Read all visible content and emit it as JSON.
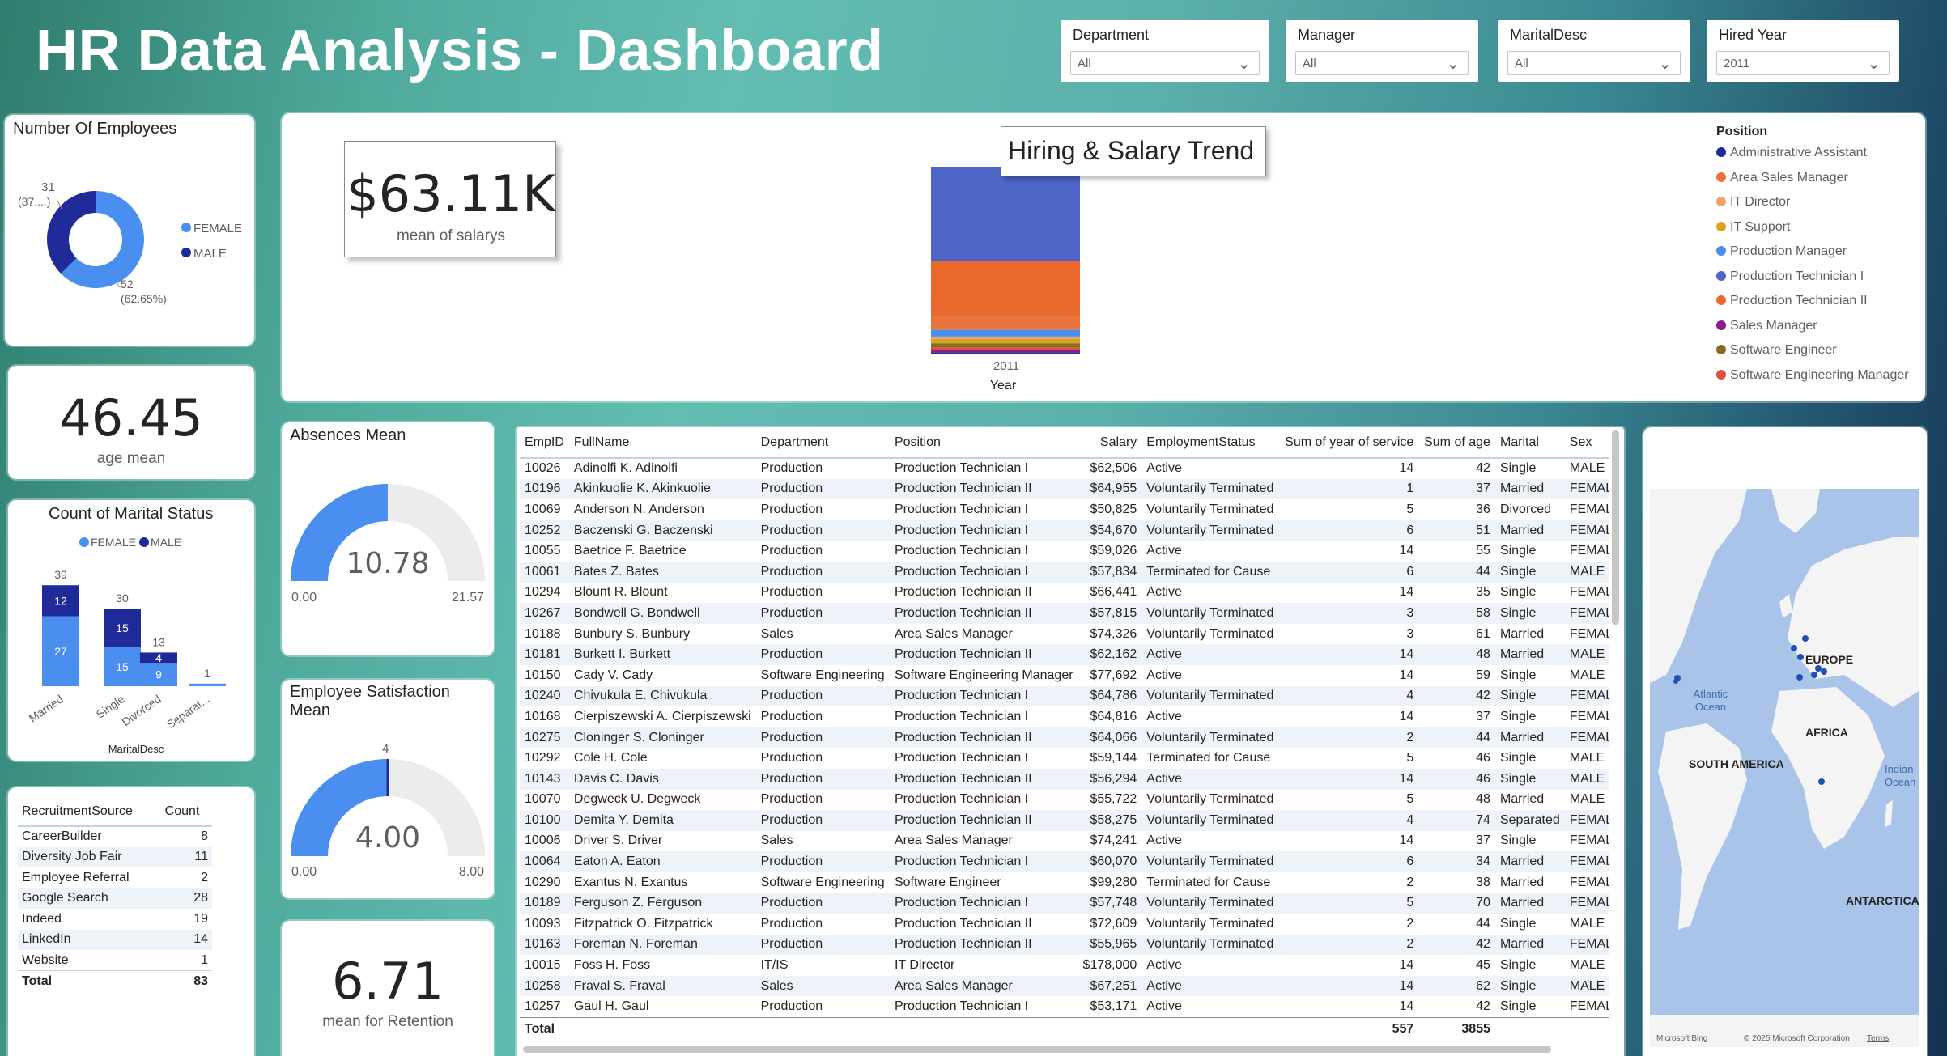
{
  "title": "HR Data Analysis - Dashboard",
  "slicers": [
    {
      "label": "Department",
      "value": "All"
    },
    {
      "label": "Manager",
      "value": "All"
    },
    {
      "label": "MaritalDesc",
      "value": "All"
    },
    {
      "label": "Hired Year",
      "value": "2011"
    }
  ],
  "employees_card": {
    "title": "Number Of Employees",
    "male_label_count": "31",
    "male_label_pct": "(37....)",
    "female_label_count": "52",
    "female_label_pct": "(62.65%)",
    "legend": [
      {
        "name": "FEMALE",
        "color": "#4a8ef0"
      },
      {
        "name": "MALE",
        "color": "#1f2b99"
      }
    ]
  },
  "age_card": {
    "value": "46.45",
    "label": "age mean"
  },
  "marital_card": {
    "title": "Count of Marital Status",
    "legend": [
      "FEMALE",
      "MALE"
    ],
    "xlabel": "MaritalDesc"
  },
  "recruitment": {
    "headers": [
      "RecruitmentSource",
      "Count"
    ],
    "rows": [
      [
        "CareerBuilder",
        "8"
      ],
      [
        "Diversity Job Fair",
        "11"
      ],
      [
        "Employee Referral",
        "2"
      ],
      [
        "Google Search",
        "28"
      ],
      [
        "Indeed",
        "19"
      ],
      [
        "LinkedIn",
        "14"
      ],
      [
        "Website",
        "1"
      ]
    ],
    "total_label": "Total",
    "total_value": "83"
  },
  "salary_card": {
    "value": "$63.11K",
    "label": "mean of salarys"
  },
  "trend": {
    "title": "Hiring & Salary Trend",
    "x_tick": "2011",
    "xlabel": "Year",
    "legend_title": "Position"
  },
  "absences": {
    "title": "Absences Mean",
    "value": "10.78",
    "min": "0.00",
    "max": "21.57"
  },
  "satisfaction": {
    "title_line1": "Employee Satisfaction",
    "title_line2": "Mean",
    "value": "4.00",
    "min": "0.00",
    "max": "8.00",
    "target": "4"
  },
  "retention": {
    "value": "6.71",
    "label": "mean for Retention"
  },
  "employee_table": {
    "headers": [
      "EmpID",
      "FullName",
      "Department",
      "Position",
      "Salary",
      "EmploymentStatus",
      "Sum of year of service",
      "Sum of age",
      "Marital",
      "Sex"
    ],
    "rows": [
      [
        "10026",
        "Adinolfi K. Adinolfi",
        "Production",
        "Production Technician I",
        "$62,506",
        "Active",
        "14",
        "42",
        "Single",
        "MALE"
      ],
      [
        "10196",
        "Akinkuolie K. Akinkuolie",
        "Production",
        "Production Technician II",
        "$64,955",
        "Voluntarily Terminated",
        "1",
        "37",
        "Married",
        "FEMAL"
      ],
      [
        "10069",
        "Anderson N. Anderson",
        "Production",
        "Production Technician I",
        "$50,825",
        "Voluntarily Terminated",
        "5",
        "36",
        "Divorced",
        "FEMAL"
      ],
      [
        "10252",
        "Baczenski G. Baczenski",
        "Production",
        "Production Technician I",
        "$54,670",
        "Voluntarily Terminated",
        "6",
        "51",
        "Married",
        "FEMAL"
      ],
      [
        "10055",
        "Baetrice F. Baetrice",
        "Production",
        "Production Technician I",
        "$59,026",
        "Active",
        "14",
        "55",
        "Single",
        "FEMAL"
      ],
      [
        "10061",
        "Bates Z. Bates",
        "Production",
        "Production Technician I",
        "$57,834",
        "Terminated for Cause",
        "6",
        "44",
        "Single",
        "MALE"
      ],
      [
        "10294",
        "Blount R. Blount",
        "Production",
        "Production Technician II",
        "$66,441",
        "Active",
        "14",
        "35",
        "Single",
        "FEMAL"
      ],
      [
        "10267",
        "Bondwell G. Bondwell",
        "Production",
        "Production Technician II",
        "$57,815",
        "Voluntarily Terminated",
        "3",
        "58",
        "Single",
        "FEMAL"
      ],
      [
        "10188",
        "Bunbury S. Bunbury",
        "Sales",
        "Area Sales Manager",
        "$74,326",
        "Voluntarily Terminated",
        "3",
        "61",
        "Married",
        "FEMAL"
      ],
      [
        "10181",
        "Burkett I. Burkett",
        "Production",
        "Production Technician II",
        "$62,162",
        "Active",
        "14",
        "48",
        "Married",
        "MALE"
      ],
      [
        "10150",
        "Cady V. Cady",
        "Software Engineering",
        "Software Engineering Manager",
        "$77,692",
        "Active",
        "14",
        "59",
        "Single",
        "MALE"
      ],
      [
        "10240",
        "Chivukula E. Chivukula",
        "Production",
        "Production Technician I",
        "$64,786",
        "Voluntarily Terminated",
        "4",
        "42",
        "Single",
        "FEMAL"
      ],
      [
        "10168",
        "Cierpiszewski A. Cierpiszewski",
        "Production",
        "Production Technician I",
        "$64,816",
        "Active",
        "14",
        "37",
        "Single",
        "FEMAL"
      ],
      [
        "10275",
        "Cloninger S. Cloninger",
        "Production",
        "Production Technician II",
        "$64,066",
        "Voluntarily Terminated",
        "2",
        "44",
        "Married",
        "FEMAL"
      ],
      [
        "10292",
        "Cole H. Cole",
        "Production",
        "Production Technician I",
        "$59,144",
        "Terminated for Cause",
        "5",
        "46",
        "Single",
        "MALE"
      ],
      [
        "10143",
        "Davis C. Davis",
        "Production",
        "Production Technician II",
        "$56,294",
        "Active",
        "14",
        "46",
        "Single",
        "MALE"
      ],
      [
        "10070",
        "Degweck U. Degweck",
        "Production",
        "Production Technician I",
        "$55,722",
        "Voluntarily Terminated",
        "5",
        "48",
        "Married",
        "MALE"
      ],
      [
        "10100",
        "Demita Y. Demita",
        "Production",
        "Production Technician II",
        "$58,275",
        "Voluntarily Terminated",
        "4",
        "74",
        "Separated",
        "FEMAL"
      ],
      [
        "10006",
        "Driver S. Driver",
        "Sales",
        "Area Sales Manager",
        "$74,241",
        "Active",
        "14",
        "37",
        "Single",
        "FEMAL"
      ],
      [
        "10064",
        "Eaton A. Eaton",
        "Production",
        "Production Technician I",
        "$60,070",
        "Voluntarily Terminated",
        "6",
        "34",
        "Married",
        "FEMAL"
      ],
      [
        "10290",
        "Exantus N. Exantus",
        "Software Engineering",
        "Software Engineer",
        "$99,280",
        "Terminated for Cause",
        "2",
        "38",
        "Married",
        "FEMAL"
      ],
      [
        "10189",
        "Ferguson Z. Ferguson",
        "Production",
        "Production Technician I",
        "$57,748",
        "Voluntarily Terminated",
        "5",
        "70",
        "Married",
        "FEMAL"
      ],
      [
        "10093",
        "Fitzpatrick O. Fitzpatrick",
        "Production",
        "Production Technician II",
        "$72,609",
        "Voluntarily Terminated",
        "2",
        "44",
        "Single",
        "MALE"
      ],
      [
        "10163",
        "Foreman N. Foreman",
        "Production",
        "Production Technician II",
        "$55,965",
        "Voluntarily Terminated",
        "2",
        "42",
        "Married",
        "FEMAL"
      ],
      [
        "10015",
        "Foss H. Foss",
        "IT/IS",
        "IT Director",
        "$178,000",
        "Active",
        "14",
        "45",
        "Single",
        "MALE"
      ],
      [
        "10258",
        "Fraval S. Fraval",
        "Sales",
        "Area Sales Manager",
        "$67,251",
        "Active",
        "14",
        "62",
        "Single",
        "MALE"
      ],
      [
        "10257",
        "Gaul H. Gaul",
        "Production",
        "Production Technician I",
        "$53,171",
        "Active",
        "14",
        "42",
        "Single",
        "FEMAL"
      ]
    ],
    "total_label": "Total",
    "total_service": "557",
    "total_age": "3855"
  },
  "map": {
    "labels": {
      "europe": "EUROPE",
      "atlantic1": "Atlantic",
      "atlantic2": "Ocean",
      "africa": "AFRICA",
      "south_america": "SOUTH AMERICA",
      "indian1": "Indian",
      "indian2": "Ocean",
      "antarctica": "ANTARCTICA"
    },
    "footer_left": "Microsoft Bing",
    "footer_right": "© 2025 Microsoft Corporation",
    "footer_terms": "Terms"
  },
  "chart_data": [
    {
      "type": "pie",
      "title": "Number Of Employees",
      "categories": [
        "FEMALE",
        "MALE"
      ],
      "values": [
        52,
        31
      ],
      "colors": [
        "#4a8ef0",
        "#1f2b99"
      ],
      "donut": true
    },
    {
      "type": "bar",
      "title": "Count of Marital Status",
      "stacked": true,
      "categories": [
        "Married",
        "Single",
        "Divorced",
        "Separat..."
      ],
      "series": [
        {
          "name": "FEMALE",
          "values": [
            27,
            15,
            9,
            1
          ],
          "color": "#4a8ef0"
        },
        {
          "name": "MALE",
          "values": [
            12,
            15,
            4,
            0
          ],
          "color": "#1f2b99"
        }
      ],
      "totals": [
        39,
        30,
        13,
        1
      ],
      "xlabel": "MaritalDesc"
    },
    {
      "type": "bar",
      "title": "Hiring & Salary Trend",
      "stacked": true,
      "categories": [
        "2011"
      ],
      "xlabel": "Year",
      "legend_title": "Position",
      "series": [
        {
          "name": "Administrative Assistant",
          "color": "#1f2b99",
          "values": [
            1
          ]
        },
        {
          "name": "Area Sales Manager",
          "color": "#e8743b",
          "values": [
            6
          ]
        },
        {
          "name": "IT Director",
          "color": "#f0a36e",
          "values": [
            1
          ]
        },
        {
          "name": "IT Support",
          "color": "#d9a521",
          "values": [
            2
          ]
        },
        {
          "name": "Production Manager",
          "color": "#4a8ef0",
          "values": [
            3
          ]
        },
        {
          "name": "Production Technician I",
          "color": "#4e64c6",
          "values": [
            42
          ]
        },
        {
          "name": "Production Technician II",
          "color": "#e8692b",
          "values": [
            25
          ]
        },
        {
          "name": "Sales Manager",
          "color": "#8b1a8b",
          "values": [
            1
          ]
        },
        {
          "name": "Software Engineer",
          "color": "#8a6a1e",
          "values": [
            2
          ]
        },
        {
          "name": "Software Engineering Manager",
          "color": "#e0503c",
          "values": [
            1
          ]
        }
      ]
    },
    {
      "type": "gauge",
      "title": "Absences Mean",
      "value": 10.78,
      "min": 0,
      "max": 21.57
    },
    {
      "type": "gauge",
      "title": "Employee Satisfaction Mean",
      "value": 4.0,
      "min": 0,
      "max": 8.0,
      "target": 4
    }
  ]
}
